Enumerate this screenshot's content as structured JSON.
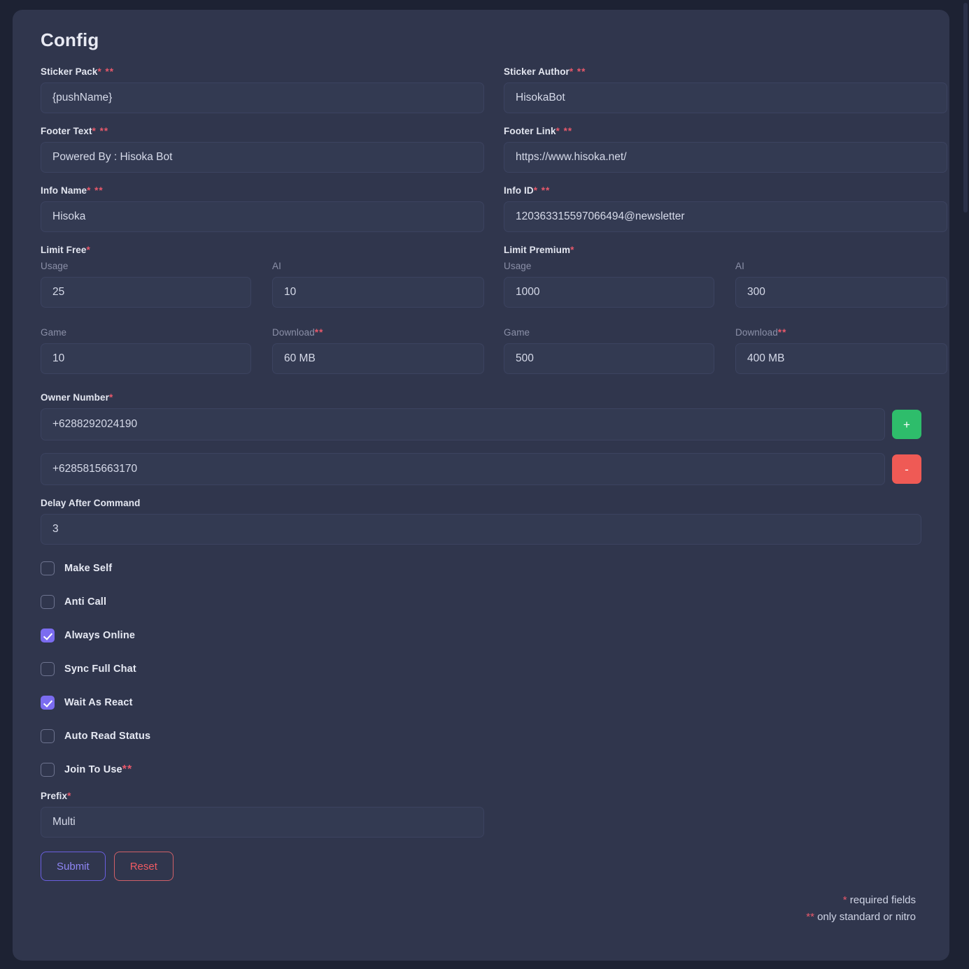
{
  "page": {
    "title": "Config"
  },
  "marks": {
    "one_star": "*",
    "two_star": "**",
    "one_two": "* **"
  },
  "fields": {
    "sticker_pack": {
      "label": "Sticker Pack",
      "mark": "* **",
      "value": "{pushName}"
    },
    "sticker_author": {
      "label": "Sticker Author",
      "mark": "* **",
      "value": "HisokaBot"
    },
    "footer_text": {
      "label": "Footer Text",
      "mark": "* **",
      "value": "Powered By : Hisoka Bot"
    },
    "footer_link": {
      "label": "Footer Link",
      "mark": "* **",
      "value": "https://www.hisoka.net/"
    },
    "info_name": {
      "label": "Info Name",
      "mark": "* **",
      "value": "Hisoka"
    },
    "info_id": {
      "label": "Info ID",
      "mark": "* **",
      "value": "120363315597066494@newsletter"
    },
    "delay_after_command": {
      "label": "Delay After Command",
      "mark": "",
      "value": "3"
    },
    "prefix": {
      "label": "Prefix",
      "mark": "*",
      "value": "Multi"
    }
  },
  "limit_free": {
    "label": "Limit Free",
    "mark": "*",
    "usage": {
      "label": "Usage",
      "mark": "",
      "value": "25"
    },
    "ai": {
      "label": "AI",
      "mark": "",
      "value": "10"
    },
    "game": {
      "label": "Game",
      "mark": "",
      "value": "10"
    },
    "download": {
      "label": "Download",
      "mark": "**",
      "value": "60 MB"
    }
  },
  "limit_premium": {
    "label": "Limit Premium",
    "mark": "*",
    "usage": {
      "label": "Usage",
      "mark": "",
      "value": "1000"
    },
    "ai": {
      "label": "AI",
      "mark": "",
      "value": "300"
    },
    "game": {
      "label": "Game",
      "mark": "",
      "value": "500"
    },
    "download": {
      "label": "Download",
      "mark": "**",
      "value": "400 MB"
    }
  },
  "owner_number": {
    "label": "Owner Number",
    "mark": "*",
    "rows": [
      {
        "value": "+6288292024190",
        "button": "+",
        "button_kind": "add"
      },
      {
        "value": "+6285815663170",
        "button": "-",
        "button_kind": "remove"
      }
    ]
  },
  "checkboxes": [
    {
      "label": "Make Self",
      "mark": "",
      "checked": false
    },
    {
      "label": "Anti Call",
      "mark": "",
      "checked": false
    },
    {
      "label": "Always Online",
      "mark": "",
      "checked": true
    },
    {
      "label": "Sync Full Chat",
      "mark": "",
      "checked": false
    },
    {
      "label": "Wait As React",
      "mark": "",
      "checked": true
    },
    {
      "label": "Auto Read Status",
      "mark": "",
      "checked": false
    },
    {
      "label": "Join To Use",
      "mark": "**",
      "checked": false
    }
  ],
  "actions": {
    "submit_label": "Submit",
    "reset_label": "Reset"
  },
  "notes": {
    "required_star": "*",
    "required_text": " required fields",
    "nitro_star": "**",
    "nitro_text": " only standard or nitro"
  },
  "colors": {
    "page_background": "#1d2233",
    "card_background": "#30364d",
    "input_background": "#333a52",
    "input_border": "#3c4360",
    "accent_purple": "#7b6cf0",
    "danger_red": "#ef5a55",
    "success_green": "#2ebd6b",
    "required_red": "#e8596b",
    "label_text": "#e3e6f0",
    "muted_text": "#8b90a8"
  }
}
